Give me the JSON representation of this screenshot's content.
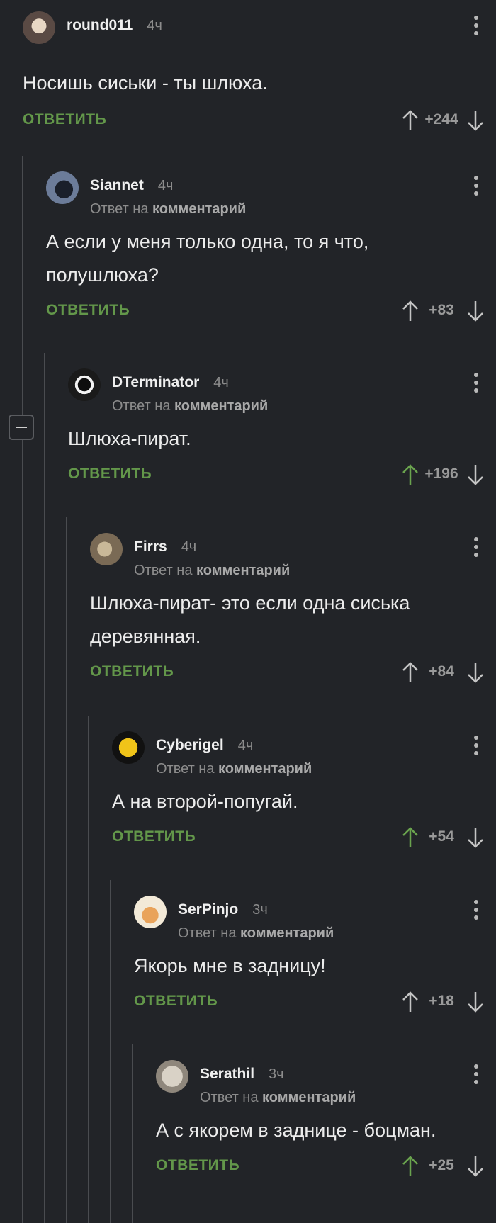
{
  "comments": [
    {
      "author": "round011",
      "time": "4ч",
      "reply_prefix": "",
      "reply_target": "",
      "text": "Носишь сиськи - ты шлюха.",
      "reply_label": "ОТВЕТИТЬ",
      "score": "+244",
      "upvoted": false
    },
    {
      "author": "Siannet",
      "time": "4ч",
      "reply_prefix": "Ответ на",
      "reply_target": "комментарий",
      "text": "А если у меня только одна, то я что, полушлюха?",
      "reply_label": "ОТВЕТИТЬ",
      "score": "+83",
      "upvoted": false
    },
    {
      "author": "DTerminator",
      "time": "4ч",
      "reply_prefix": "Ответ на",
      "reply_target": "комментарий",
      "text": "Шлюха-пират.",
      "reply_label": "ОТВЕТИТЬ",
      "score": "+196",
      "upvoted": true
    },
    {
      "author": "Firrs",
      "time": "4ч",
      "reply_prefix": "Ответ на",
      "reply_target": "комментарий",
      "text": "Шлюха-пират- это если одна сиська деревянная.",
      "reply_label": "ОТВЕТИТЬ",
      "score": "+84",
      "upvoted": false
    },
    {
      "author": "Cyberigel",
      "time": "4ч",
      "reply_prefix": "Ответ на",
      "reply_target": "комментарий",
      "text": "А на второй-попугай.",
      "reply_label": "ОТВЕТИТЬ",
      "score": "+54",
      "upvoted": true
    },
    {
      "author": "SerPinjo",
      "time": "3ч",
      "reply_prefix": "Ответ на",
      "reply_target": "комментарий",
      "text": "Якорь мне в задницу!",
      "reply_label": "ОТВЕТИТЬ",
      "score": "+18",
      "upvoted": false
    },
    {
      "author": "Serathil",
      "time": "3ч",
      "reply_prefix": "Ответ на",
      "reply_target": "комментарий",
      "text": "А с якорем в заднице - боцман.",
      "reply_label": "ОТВЕТИТЬ",
      "score": "+25",
      "upvoted": true
    }
  ],
  "colors": {
    "background": "#222428",
    "accent_green": "#63974a",
    "upvoted_arrow": "#6aa34e",
    "arrow_default": "#c4c4c4",
    "thread_line": "#4a4c50"
  },
  "icons": {
    "more": "more-vertical-icon",
    "up": "arrow-up-icon",
    "down": "arrow-down-icon",
    "collapse": "minus-icon"
  }
}
